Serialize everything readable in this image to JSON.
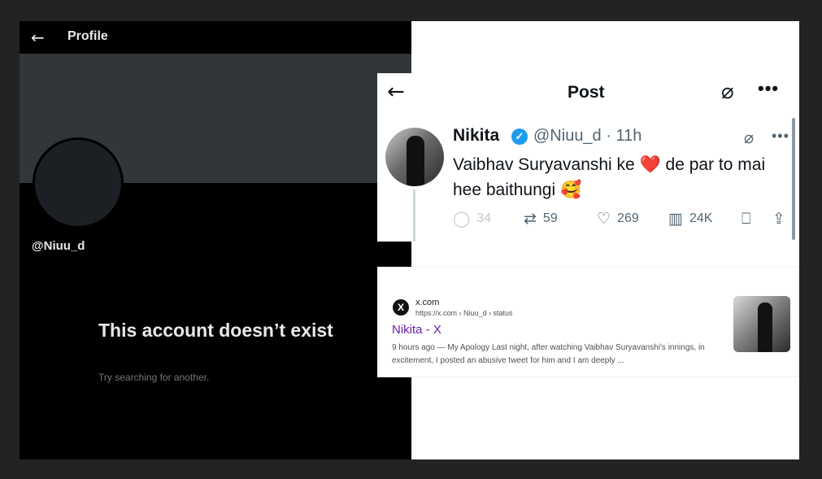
{
  "profile": {
    "header_title": "Profile",
    "back_icon": "arrow-left-icon",
    "handle": "@Niuu_d",
    "message_title": "This account doesn’t exist",
    "message_sub": "Try searching for another."
  },
  "post": {
    "header_title": "Post",
    "author_name": "Nikita",
    "meta": "@Niuu_d · 11h",
    "text": "Vaibhav Suryavanshi ke ❤️ de par to mai hee baithungi 🥰",
    "stats": {
      "replies": "34",
      "reposts": "59",
      "likes": "269",
      "views": "24K"
    }
  },
  "search_result": {
    "site_name": "x.com",
    "site_url": "https://x.com › Niuu_d › status",
    "title": "Nikita - X",
    "snippet": "9 hours ago — My Apology Last night, after watching Vaibhav Suryavanshi's innings, in excitement, I posted an abusive tweet for him and I am deeply ..."
  },
  "colors": {
    "verified": "#1d9bf0",
    "visited_link": "#681da8",
    "banner": "#333639"
  }
}
